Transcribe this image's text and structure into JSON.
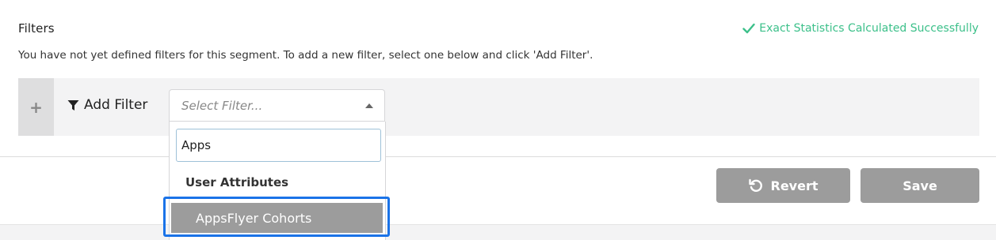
{
  "header": {
    "title": "Filters",
    "status_text": "Exact Statistics Calculated Successfully",
    "hint": "You have not yet defined filters for this segment. To add a new filter, select one below and click 'Add Filter'."
  },
  "filter_bar": {
    "add_symbol": "+",
    "add_filter_label": "Add Filter",
    "select_placeholder": "Select Filter..."
  },
  "dropdown": {
    "search_value": "Apps",
    "groups": [
      {
        "label": "User Attributes",
        "options": [
          "AppsFlyer Cohorts"
        ]
      }
    ]
  },
  "actions": {
    "revert_label": "Revert",
    "save_label": "Save"
  },
  "colors": {
    "success": "#3cc08a",
    "button": "#9c9c9c",
    "highlight": "#1a73e8"
  },
  "icons": [
    "check-icon",
    "plus-icon",
    "funnel-icon",
    "caret-up-icon",
    "revert-icon"
  ]
}
